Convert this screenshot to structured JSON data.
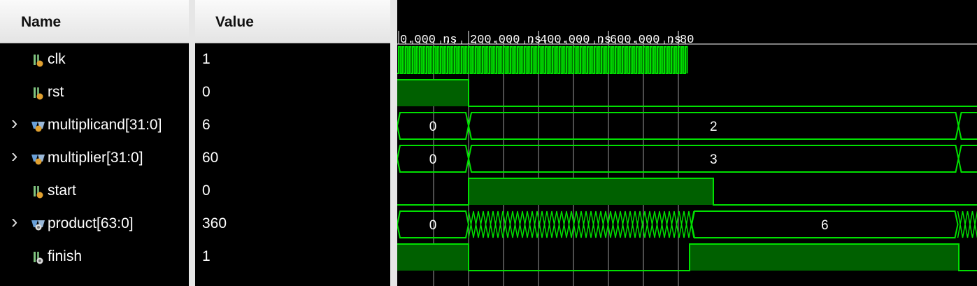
{
  "columns": {
    "name": "Name",
    "value": "Value"
  },
  "timeline": {
    "ticks": [
      "0.000 ns",
      "200.000 ns",
      "400.000 ns",
      "600.000 ns",
      "80"
    ]
  },
  "signals": [
    {
      "name": "clk",
      "value": "1",
      "expandable": false,
      "icon": "scalar-signal-icon"
    },
    {
      "name": "rst",
      "value": "0",
      "expandable": false,
      "icon": "scalar-signal-icon"
    },
    {
      "name": "multiplicand[31:0]",
      "value": "6",
      "expandable": true,
      "icon": "bus-signal-icon"
    },
    {
      "name": "multiplier[31:0]",
      "value": "60",
      "expandable": true,
      "icon": "bus-signal-icon"
    },
    {
      "name": "start",
      "value": "0",
      "expandable": false,
      "icon": "scalar-signal-icon"
    },
    {
      "name": "product[63:0]",
      "value": "360",
      "expandable": true,
      "icon": "bus-output-icon"
    },
    {
      "name": "finish",
      "value": "1",
      "expandable": false,
      "icon": "scalar-output-icon"
    }
  ],
  "waves": {
    "multiplicand_labels": [
      "0",
      "2"
    ],
    "multiplier_labels": [
      "0",
      "3"
    ],
    "product_labels": [
      "0",
      "6"
    ]
  },
  "colors": {
    "wave": "#00e000",
    "fill": "#006000",
    "grid": "#9a9a9a",
    "background": "#000000",
    "header": "#eeeeee"
  }
}
